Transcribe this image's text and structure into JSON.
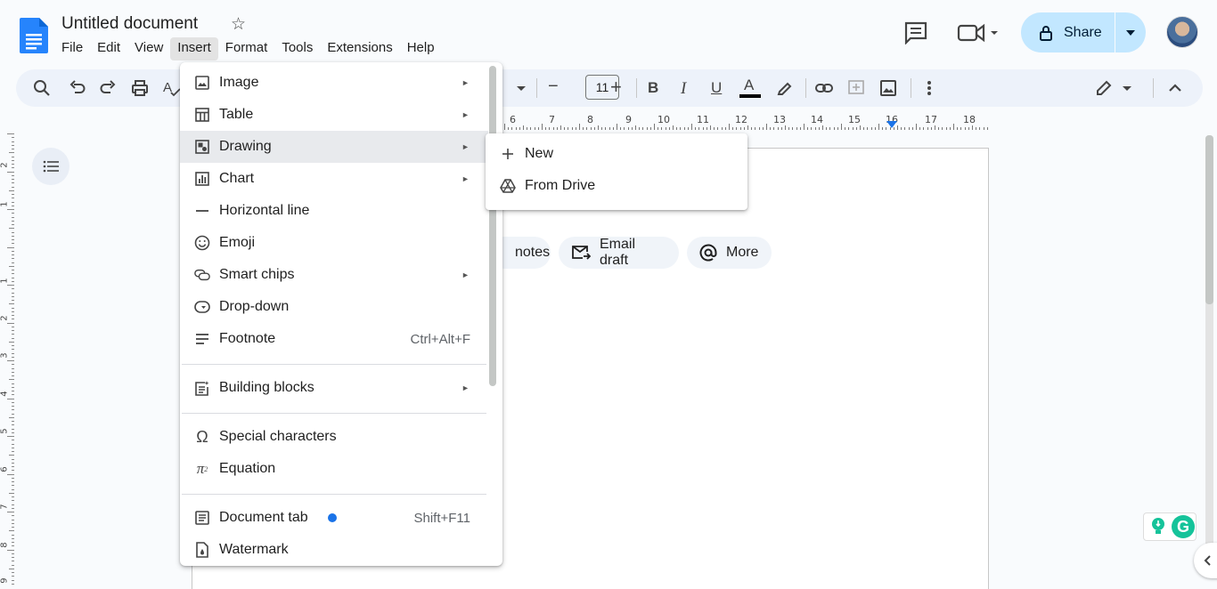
{
  "header": {
    "doc_title": "Untitled document",
    "menubar": [
      "File",
      "Edit",
      "View",
      "Insert",
      "Format",
      "Tools",
      "Extensions",
      "Help"
    ],
    "active_menu": "Insert",
    "share_label": "Share"
  },
  "toolbar": {
    "font_size": "11",
    "font_size_minus": "−",
    "font_size_plus": "+",
    "bold": "B",
    "italic": "I",
    "underline": "U",
    "text_color": "A"
  },
  "ruler": {
    "numbers": [
      "6",
      "7",
      "8",
      "9",
      "10",
      "11",
      "12",
      "13",
      "14",
      "15",
      "16",
      "17",
      "18"
    ]
  },
  "vertical_ruler": {
    "numbers": [
      "2",
      "1",
      "1",
      "2",
      "3",
      "4",
      "5",
      "6",
      "7",
      "8",
      "9"
    ]
  },
  "chips": {
    "meeting_notes_partial": "notes",
    "email_draft": "Email draft",
    "more": "More"
  },
  "insert_menu": {
    "items": [
      {
        "label": "Image",
        "icon": "image-icon",
        "submenu": true
      },
      {
        "label": "Table",
        "icon": "table-icon",
        "submenu": true
      },
      {
        "label": "Drawing",
        "icon": "drawing-icon",
        "submenu": true
      },
      {
        "label": "Chart",
        "icon": "chart-icon",
        "submenu": true
      },
      {
        "label": "Horizontal line",
        "icon": "horizontal-line-icon"
      },
      {
        "label": "Emoji",
        "icon": "emoji-icon"
      },
      {
        "label": "Smart chips",
        "icon": "smart-chips-icon",
        "submenu": true
      },
      {
        "label": "Drop-down",
        "icon": "dropdown-icon"
      },
      {
        "label": "Footnote",
        "icon": "footnote-icon",
        "shortcut": "Ctrl+Alt+F"
      },
      {
        "label": "Building blocks",
        "icon": "building-blocks-icon",
        "submenu": true
      },
      {
        "label": "Special characters",
        "icon": "omega-icon"
      },
      {
        "label": "Equation",
        "icon": "pi-icon"
      },
      {
        "label": "Document tab",
        "icon": "document-tab-icon",
        "shortcut": "Shift+F11"
      },
      {
        "label": "Watermark",
        "icon": "watermark-icon"
      }
    ],
    "arrow": "►",
    "hovered": "Drawing"
  },
  "drawing_submenu": {
    "items": [
      {
        "label": "New",
        "icon": "plus-icon"
      },
      {
        "label": "From Drive",
        "icon": "drive-icon"
      }
    ]
  },
  "grammarly": {
    "logo_letter": "G"
  },
  "colors": {
    "accent": "#1a73e8",
    "share_bg": "#c2e7ff",
    "toolbar_bg": "#edf2fa",
    "menu_hover": "#e8eaed"
  }
}
